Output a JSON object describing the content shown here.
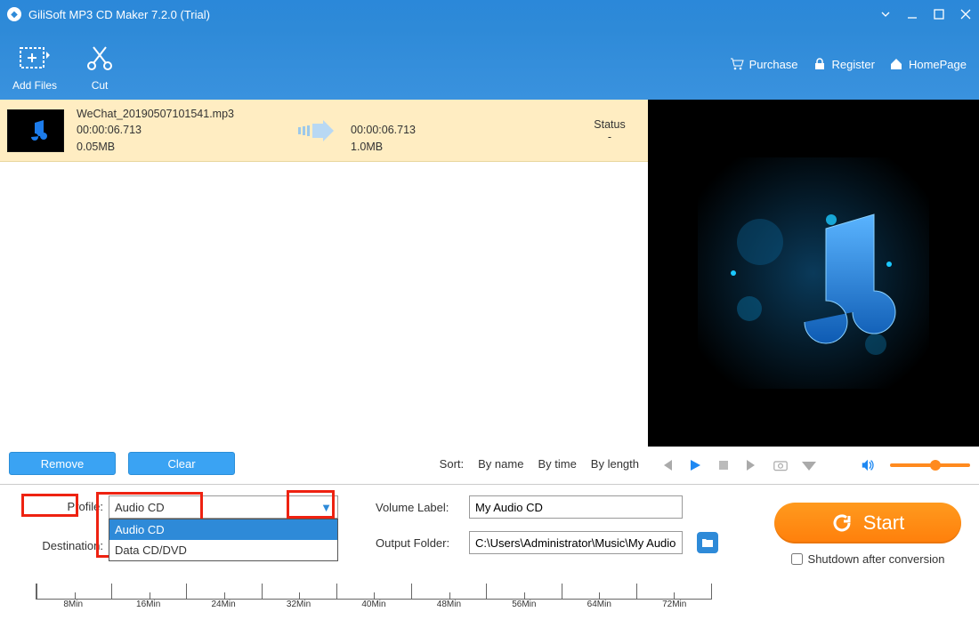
{
  "window": {
    "title": "GiliSoft MP3 CD Maker 7.2.0 (Trial)"
  },
  "toolbar": {
    "add_files": "Add Files",
    "cut": "Cut",
    "purchase": "Purchase",
    "register": "Register",
    "homepage": "HomePage"
  },
  "file": {
    "name": "WeChat_20190507101541.mp3",
    "duration_in": "00:00:06.713",
    "size_in": "0.05MB",
    "duration_out": "00:00:06.713",
    "size_out": "1.0MB",
    "status_header": "Status",
    "status_value": "-"
  },
  "list_actions": {
    "remove": "Remove",
    "clear": "Clear"
  },
  "sort": {
    "label": "Sort:",
    "by_name": "By name",
    "by_time": "By time",
    "by_length": "By length"
  },
  "settings": {
    "profile_label": "Profile:",
    "profile_value": "Audio CD",
    "profile_options": [
      "Audio CD",
      "Data CD/DVD"
    ],
    "destination_label": "Destination:",
    "destination_value": "",
    "volume_label_label": "Volume Label:",
    "volume_label_value": "My Audio CD",
    "output_folder_label": "Output Folder:",
    "output_folder_value": "C:\\Users\\Administrator\\Music\\My Audio"
  },
  "start": {
    "label": "Start",
    "shutdown_label": "Shutdown after conversion"
  },
  "ruler": {
    "labels": [
      "8Min",
      "16Min",
      "24Min",
      "32Min",
      "40Min",
      "48Min",
      "56Min",
      "64Min",
      "72Min"
    ]
  }
}
